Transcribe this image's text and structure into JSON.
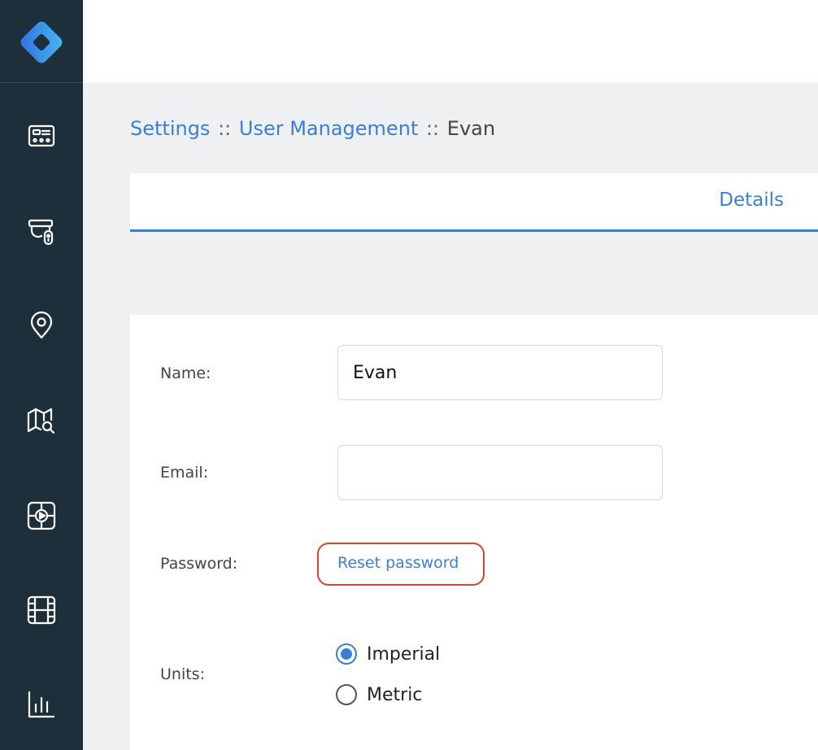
{
  "sidebar": {
    "icons": [
      "app-logo-icon",
      "dashboard-card-icon",
      "device-key-icon",
      "location-pin-icon",
      "map-search-icon",
      "video-play-icon",
      "film-strip-icon",
      "bar-chart-icon"
    ]
  },
  "breadcrumb": {
    "settings": "Settings",
    "separator": "::",
    "user_management": "User Management",
    "current": "Evan"
  },
  "tabs": {
    "details": "Details"
  },
  "form": {
    "name_label": "Name:",
    "name_value": "Evan",
    "email_label": "Email:",
    "email_value": "",
    "password_label": "Password:",
    "reset_password": "Reset password",
    "units_label": "Units:",
    "units_options": [
      {
        "label": "Imperial",
        "selected": true
      },
      {
        "label": "Metric",
        "selected": false
      }
    ]
  },
  "colors": {
    "sidebar_bg": "#1d2f3a",
    "accent": "#3b7fd4",
    "highlight_ring": "#d9442f",
    "page_bg": "#eef0f2"
  }
}
